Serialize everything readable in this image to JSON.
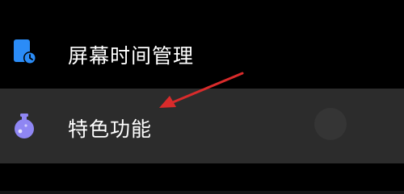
{
  "settings_list": {
    "items": [
      {
        "label": "屏幕时间管理",
        "icon": "screen-time-icon",
        "icon_color": "#2b8cf7"
      },
      {
        "label": "特色功能",
        "icon": "flask-icon",
        "icon_color": "#8f86f3",
        "highlighted": true
      }
    ]
  },
  "annotation": {
    "arrow_color": "#d92b2b",
    "points_to": "特色功能"
  }
}
